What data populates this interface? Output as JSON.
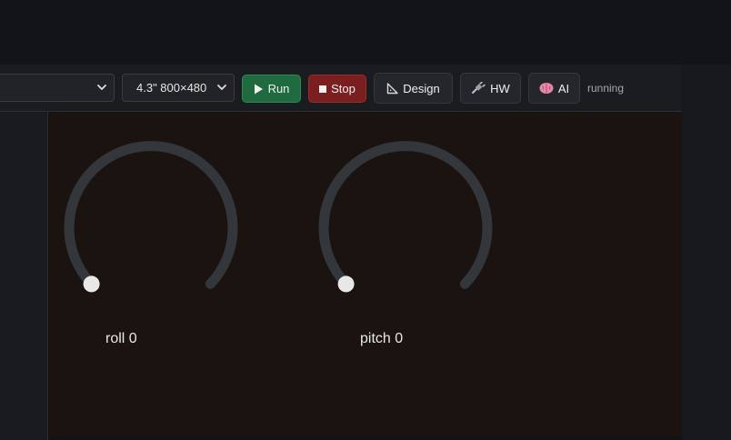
{
  "toolbar": {
    "project_select": {
      "value": ""
    },
    "display_select": {
      "value": "4.3\" 800×480"
    },
    "run_label": "Run",
    "stop_label": "Stop",
    "design_label": "Design",
    "hw_label": "HW",
    "ai_label": "AI",
    "status_text": "running"
  },
  "canvas": {
    "gauges": [
      {
        "label": "roll 0",
        "value": 0
      },
      {
        "label": "pitch 0",
        "value": 0
      }
    ]
  },
  "colors": {
    "run_button": "#1f6b3f",
    "stop_button": "#7b1e20",
    "gauge_track": "#33363b",
    "gauge_indicator": "#e8e8e8",
    "canvas_bg": "#1a1310"
  },
  "icons": {
    "run": "play-icon",
    "stop": "stop-icon",
    "design": "ruler-triangle-icon",
    "hw": "plug-icon",
    "ai": "brain-icon",
    "select": "chevron-down-icon"
  }
}
